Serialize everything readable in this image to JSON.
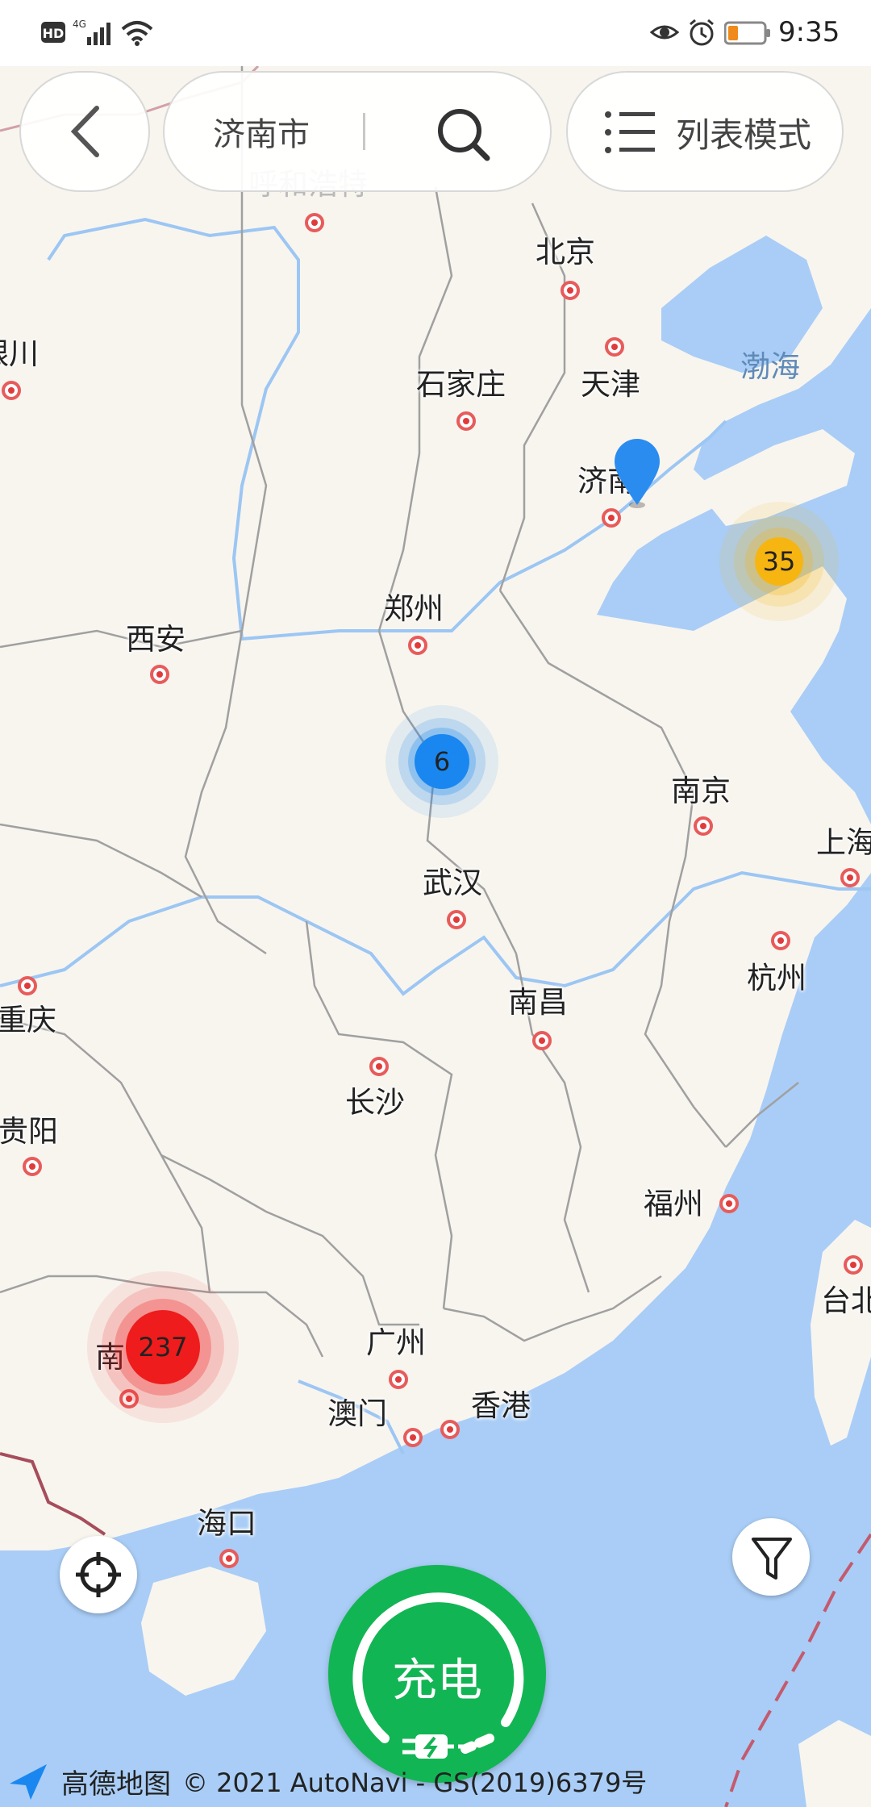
{
  "status_bar": {
    "left_icons": [
      "hd-icon",
      "4g-signal-icon",
      "wifi-icon"
    ],
    "hd_label": "HD",
    "network_label": "4G",
    "right_icons": [
      "eye-icon",
      "alarm-icon",
      "battery-icon"
    ],
    "time": "9:35"
  },
  "search_bar": {
    "city": "济南市",
    "back_icon": "chevron-left-icon",
    "search_icon": "search-icon"
  },
  "view_toggle": {
    "icon": "list-icon",
    "label": "列表模式"
  },
  "map": {
    "faint_label": "呼和浩特",
    "cities": [
      {
        "name": "北京"
      },
      {
        "name": "天津"
      },
      {
        "name": "石家庄"
      },
      {
        "name": "济南"
      },
      {
        "name": "郑州"
      },
      {
        "name": "西安"
      },
      {
        "name": "银川"
      },
      {
        "name": "南京"
      },
      {
        "name": "上海"
      },
      {
        "name": "武汉"
      },
      {
        "name": "杭州"
      },
      {
        "name": "重庆"
      },
      {
        "name": "南昌"
      },
      {
        "name": "长沙"
      },
      {
        "name": "贵阳"
      },
      {
        "name": "福州"
      },
      {
        "name": "台北"
      },
      {
        "name": "广州"
      },
      {
        "name": "澳门"
      },
      {
        "name": "香港"
      },
      {
        "name": "南宁"
      },
      {
        "name": "海口"
      }
    ],
    "sea_label": "渤海",
    "clusters": [
      {
        "count": "35",
        "color": "#f6b511"
      },
      {
        "count": "6",
        "color": "#1a87f0"
      },
      {
        "count": "237",
        "color": "#ee1c1c"
      }
    ],
    "pin_color": "#2b8cf0"
  },
  "controls": {
    "locate_icon": "crosshair-icon",
    "filter_icon": "filter-icon",
    "charge_label": "充电",
    "charge_icon": "charging-plug-icon"
  },
  "footer": {
    "logo_icon": "amap-arrow-icon",
    "logo_text": "高德地图",
    "copyright": "© 2021 AutoNavi - GS(2019)6379号"
  },
  "colors": {
    "sea": "#a9cdf6",
    "land": "#f8f5ef",
    "accent_green": "#12b553",
    "river": "#9cc6f3",
    "border": "#9a9a9a"
  }
}
